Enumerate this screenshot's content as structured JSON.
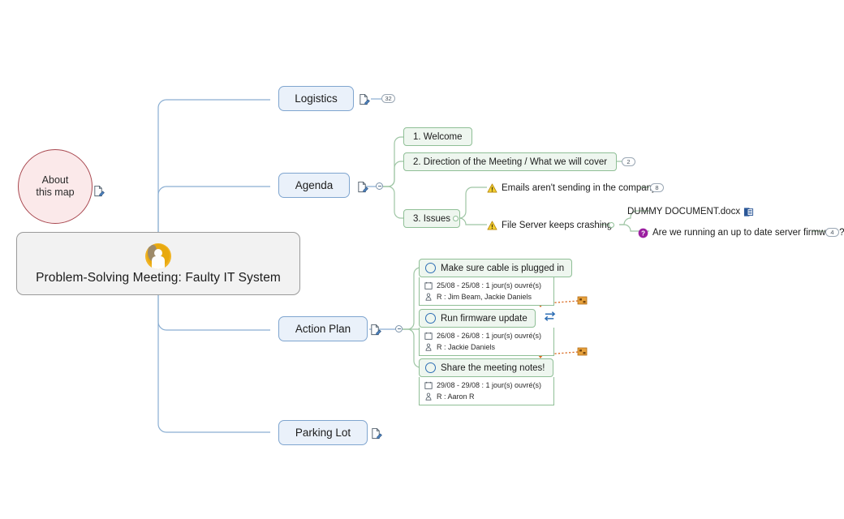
{
  "map": {
    "central": {
      "title": "Problem-Solving Meeting: Faulty IT System",
      "avatar_icon": "user-avatar-icon"
    },
    "about": {
      "label": "About\nthis map",
      "note_icon": "note-icon"
    },
    "branches": [
      {
        "label": "Logistics",
        "note_icon": "note-icon",
        "badge": "32"
      },
      {
        "label": "Agenda",
        "note_icon": "note-icon",
        "badge": ""
      },
      {
        "label": "Action Plan",
        "note_icon": "note-icon",
        "badge": ""
      },
      {
        "label": "Parking Lot",
        "note_icon": "note-icon",
        "badge": ""
      }
    ],
    "agenda_items": [
      {
        "label": "1. Welcome",
        "badge": ""
      },
      {
        "label": "2. Direction of the Meeting / What we will cover",
        "badge": "2"
      },
      {
        "label": "3. Issues",
        "badge": ""
      }
    ],
    "issues": [
      {
        "icon": "warning-icon",
        "label": "Emails aren't sending in the company",
        "badge": "8"
      },
      {
        "icon": "warning-icon",
        "label": "File Server keeps crashing",
        "badge": ""
      }
    ],
    "issue_children": [
      {
        "icon": "docx-icon",
        "label": "DUMMY DOCUMENT.docx",
        "badge": ""
      },
      {
        "icon": "question-icon",
        "label": "Are we running an up to date server firmware?",
        "badge": "4"
      }
    ],
    "tasks": [
      {
        "title": "Make sure cable is plugged in",
        "dates": "25/08 - 25/08 : 1 jour(s) ouvré(s)",
        "resource": "R : Jim Beam, Jackie Daniels",
        "sync_icon": "",
        "calendar_icon": "calendar-icon",
        "person_icon": "person-icon"
      },
      {
        "title": "Run firmware update",
        "dates": "26/08 - 26/08 : 1 jour(s) ouvré(s)",
        "resource": "R : Jackie Daniels",
        "sync_icon": "sync-icon",
        "calendar_icon": "calendar-icon",
        "person_icon": "person-icon"
      },
      {
        "title": "Share the meeting notes!",
        "dates": "29/08 - 29/08 : 1 jour(s) ouvré(s)",
        "resource": "R : Aaron R",
        "sync_icon": "",
        "calendar_icon": "calendar-icon",
        "person_icon": "person-icon"
      }
    ],
    "colors": {
      "branch_fill": "#eaf1fa",
      "branch_stroke": "#7fa5cf",
      "green_fill": "#eef6ef",
      "green_stroke": "#8fbf96",
      "about_fill": "#fbe9ea",
      "about_stroke": "#a8474f",
      "central_fill": "#f2f2f2",
      "central_stroke": "#9a9a9a",
      "wire_blue": "#8aaed2",
      "wire_green": "#9ec5a4",
      "relation_orange": "#d96a20",
      "avatar_gold": "#f0b323",
      "question_purple": "#9b1fa0",
      "warning_yellow": "#f5c518"
    }
  }
}
